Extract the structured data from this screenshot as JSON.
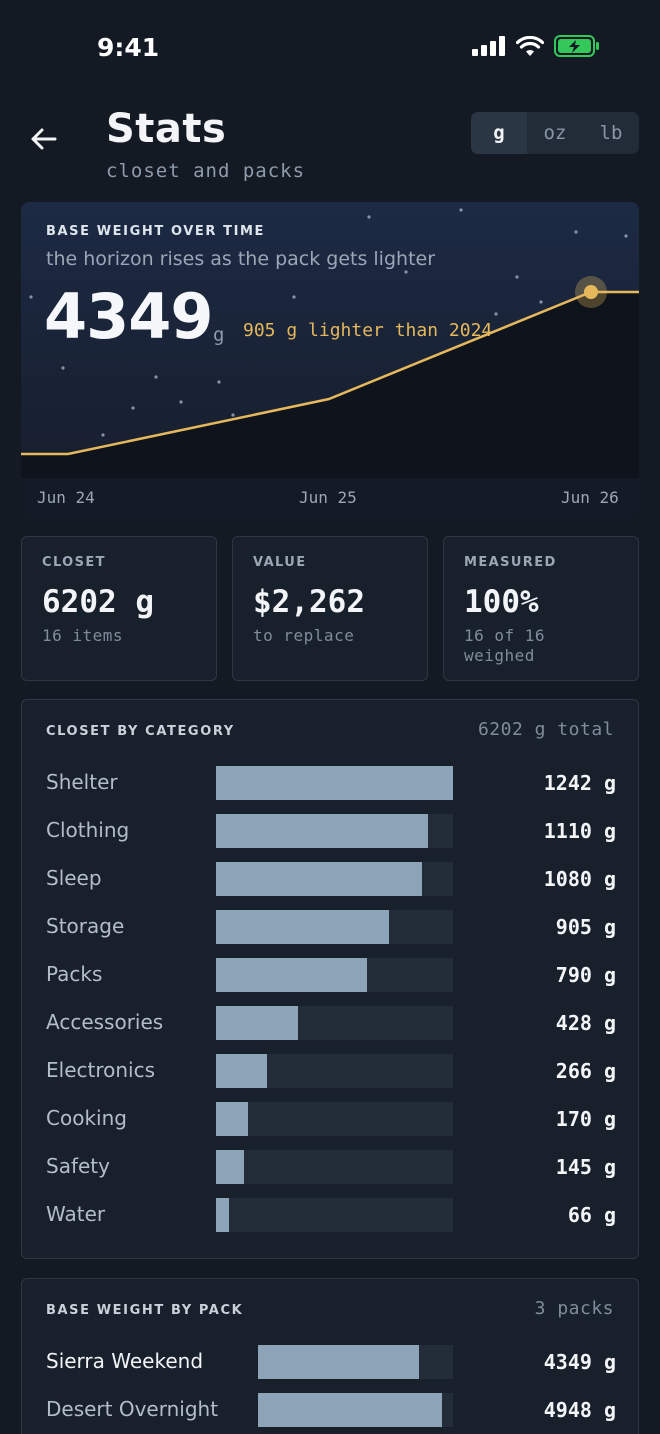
{
  "status": {
    "time": "9:41"
  },
  "header": {
    "title": "Stats",
    "subtitle": "closet and packs",
    "units": [
      "g",
      "oz",
      "lb"
    ],
    "active_unit": "g"
  },
  "hero": {
    "label": "BASE WEIGHT OVER TIME",
    "subtitle": "the horizon rises as the pack gets lighter",
    "value": "4349",
    "unit": "g",
    "delta": "905 g lighter than 2024",
    "accent": "#e6b85c"
  },
  "chart_data": {
    "type": "line",
    "title": "BASE WEIGHT OVER TIME",
    "x": [
      "Jun 24",
      "Jun 25",
      "Jun 26"
    ],
    "xlabel": "",
    "ylabel": "",
    "grid": false
  },
  "metrics": [
    {
      "label": "CLOSET",
      "value": "6202 g",
      "sub": "16 items"
    },
    {
      "label": "VALUE",
      "value": "$2,262",
      "sub": "to replace"
    },
    {
      "label": "MEASURED",
      "value": "100%",
      "sub": "16 of 16 weighed"
    }
  ],
  "categories": {
    "heading": "CLOSET BY CATEGORY",
    "total": "6202 g total",
    "max": 1242,
    "items": [
      {
        "label": "Shelter",
        "value": 1242,
        "text": "1242 g"
      },
      {
        "label": "Clothing",
        "value": 1110,
        "text": "1110 g"
      },
      {
        "label": "Sleep",
        "value": 1080,
        "text": "1080 g"
      },
      {
        "label": "Storage",
        "value": 905,
        "text": "905 g"
      },
      {
        "label": "Packs",
        "value": 790,
        "text": "790 g"
      },
      {
        "label": "Accessories",
        "value": 428,
        "text": "428 g"
      },
      {
        "label": "Electronics",
        "value": 266,
        "text": "266 g"
      },
      {
        "label": "Cooking",
        "value": 170,
        "text": "170 g"
      },
      {
        "label": "Safety",
        "value": 145,
        "text": "145 g"
      },
      {
        "label": "Water",
        "value": 66,
        "text": "66 g"
      }
    ]
  },
  "packs": {
    "heading": "BASE WEIGHT BY PACK",
    "count": "3 packs",
    "max": 5254,
    "items": [
      {
        "label": "Sierra Weekend",
        "value": 4349,
        "text": "4349 g"
      },
      {
        "label": "Desert Overnight",
        "value": 4948,
        "text": "4948 g"
      }
    ]
  }
}
